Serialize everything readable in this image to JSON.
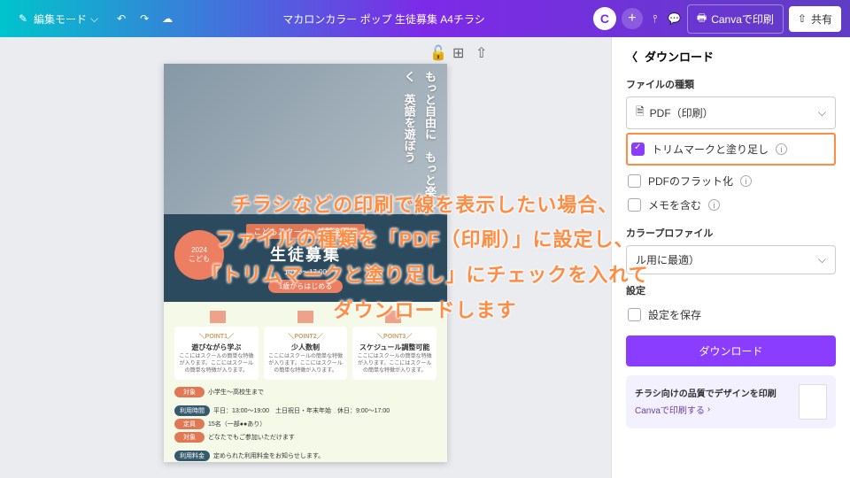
{
  "topbar": {
    "edit_mode": "編集モード",
    "title": "マカロンカラー ポップ 生徒募集 A4チラシ",
    "print_label": "Canvaで印刷",
    "share_label": "共有",
    "avatar_initial": "C"
  },
  "panel": {
    "title": "ダウンロード",
    "filetype_label": "ファイルの種類",
    "filetype_value": "PDF（印刷）",
    "trim_label": "トリムマークと塗り足し",
    "flatten_label": "PDFのフラット化",
    "memo_label": "メモを含む",
    "color_label": "カラープロファイル",
    "color_value": "ル用に最適）",
    "settings_label": "設定",
    "save_settings": "設定を保存",
    "download_btn": "ダウンロード",
    "promo_title": "チラシ向けの品質でデザインを印刷",
    "promo_link": "Canvaで印刷する"
  },
  "flyer": {
    "vert1": "もっと自由に",
    "vert2": "もっと楽しく",
    "vert3": "英語を遊ぼう",
    "event_tag": "こどもスクール・体験会開催",
    "big": "生徒募集",
    "time": "10:00～17:00",
    "pill": "1歳からはじめる",
    "pt_tag1": "＼POINT1／",
    "pt_tag2": "＼POINT2／",
    "pt_tag3": "＼POINT3／",
    "pt_t1": "遊びながら学ぶ",
    "pt_t2": "少人数制",
    "pt_t3": "スケジュール調整可能",
    "pt_d": "ここにはスクールの簡単な特徴が入ります。ここにはスクールの簡単な特徴が入ります。",
    "it1": "対象",
    "iv1": "小学生～高校生まで",
    "it2": "定員",
    "iv2": "15名（一部●●あり）",
    "it3": "対象",
    "iv3": "どなたでもご参加いただけます",
    "it4": "利用時間",
    "iv4": "平日：13:00～19:00　土日祝日・年末年始　休日：9:00～17:00",
    "it5": "利用料金",
    "iv5": "定められた利用料金をお知らせします。"
  },
  "overlay": {
    "l1": "チラシなどの印刷で線を表示したい場合、",
    "l2": "ファイルの種類を「PDF（印刷）」に設定し、",
    "l3": "「トリムマークと塗り足し」にチェックを入れて",
    "l4": "ダウンロードします"
  }
}
